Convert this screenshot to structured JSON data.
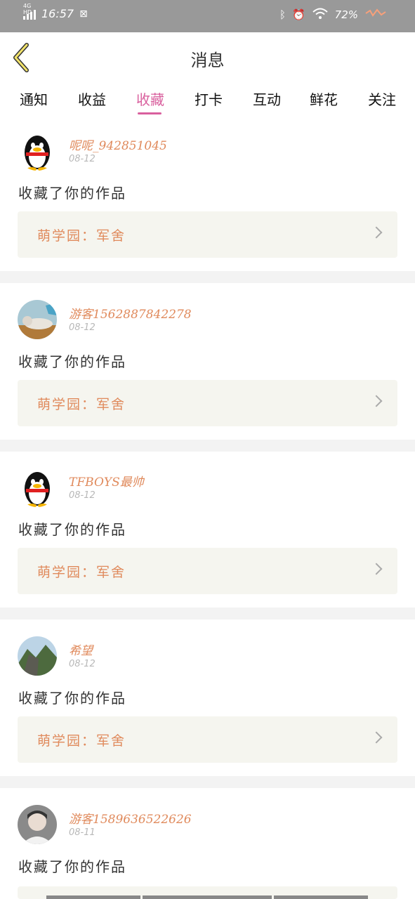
{
  "status_bar": {
    "network": "4G HD",
    "time": "16:57",
    "battery": "72%"
  },
  "header": {
    "title": "消息",
    "back_icon": "chevron-left-icon"
  },
  "tabs": [
    {
      "label": "通知",
      "active": false
    },
    {
      "label": "收益",
      "active": false
    },
    {
      "label": "收藏",
      "active": true
    },
    {
      "label": "打卡",
      "active": false
    },
    {
      "label": "互动",
      "active": false
    },
    {
      "label": "鲜花",
      "active": false
    },
    {
      "label": "关注",
      "active": false
    }
  ],
  "messages": [
    {
      "username": "呢呢_942851045",
      "date": "08-12",
      "action": "收藏了你的作品",
      "work": "萌学园：军舍",
      "avatar": "qq-penguin"
    },
    {
      "username": "游客1562887842278",
      "date": "08-12",
      "action": "收藏了你的作品",
      "work": "萌学园：军舍",
      "avatar": "cat-photo"
    },
    {
      "username": "TFBOYS最帅",
      "date": "08-12",
      "action": "收藏了你的作品",
      "work": "萌学园：军舍",
      "avatar": "qq-penguin"
    },
    {
      "username": "希望",
      "date": "08-12",
      "action": "收藏了你的作品",
      "work": "萌学园：军舍",
      "avatar": "landscape-photo"
    },
    {
      "username": "游客1589636522626",
      "date": "08-11",
      "action": "收藏了你的作品",
      "work": "",
      "avatar": "person-photo"
    }
  ],
  "colors": {
    "accent": "#d9609e",
    "username": "#e08a5c",
    "work_bg": "#f5f5ef",
    "status_bar": "#999999"
  }
}
